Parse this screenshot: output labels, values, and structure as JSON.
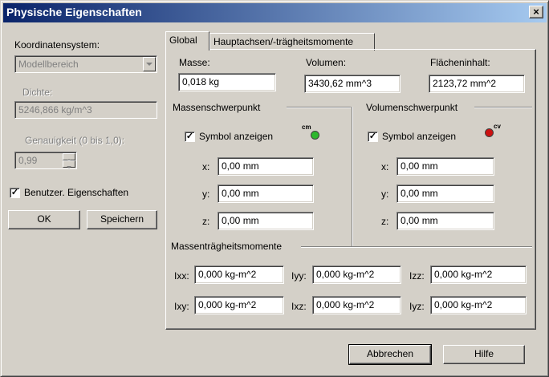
{
  "window": {
    "title": "Physische Eigenschaften",
    "close_glyph": "×"
  },
  "left": {
    "coord_label": "Koordinatensystem:",
    "coord_value": "Modellbereich",
    "density_label": "Dichte:",
    "density_value": "5246,866 kg/m^3",
    "accuracy_label": "Genauigkeit (0 bis 1,0):",
    "accuracy_value": "0,99",
    "user_props_label": "Benutzer. Eigenschaften",
    "user_props_checked": true,
    "ok_button": "OK",
    "save_button": "Speichern"
  },
  "tabs": [
    {
      "label": "Global",
      "active": true
    },
    {
      "label": "Hauptachsen/-trägheitsmomente",
      "active": false
    }
  ],
  "global": {
    "mass_label": "Masse:",
    "mass_value": "0,018 kg",
    "volume_label": "Volumen:",
    "volume_value": "3430,62 mm^3",
    "area_label": "Flächeninhalt:",
    "area_value": "2123,72 mm^2",
    "mass_center": {
      "group_label": "Massenschwerpunkt",
      "symbol_label": "Symbol anzeigen",
      "symbol_checked": true,
      "symbol_tag": "cm",
      "symbol_color": "#2eb82e",
      "x_label": "x:",
      "x_value": "0,00 mm",
      "y_label": "y:",
      "y_value": "0,00 mm",
      "z_label": "z:",
      "z_value": "0,00 mm"
    },
    "volume_center": {
      "group_label": "Volumenschwerpunkt",
      "symbol_label": "Symbol anzeigen",
      "symbol_checked": true,
      "symbol_tag": "cv",
      "symbol_color": "#cc1111",
      "x_label": "x:",
      "x_value": "0,00 mm",
      "y_label": "y:",
      "y_value": "0,00 mm",
      "z_label": "z:",
      "z_value": "0,00 mm"
    },
    "inertia": {
      "group_label": "Massenträgheitsmomente",
      "ixx_label": "Ixx:",
      "ixx_value": "0,000 kg-m^2",
      "iyy_label": "Iyy:",
      "iyy_value": "0,000 kg-m^2",
      "izz_label": "Izz:",
      "izz_value": "0,000 kg-m^2",
      "ixy_label": "Ixy:",
      "ixy_value": "0,000 kg-m^2",
      "ixz_label": "Ixz:",
      "ixz_value": "0,000 kg-m^2",
      "iyz_label": "Iyz:",
      "iyz_value": "0,000 kg-m^2"
    }
  },
  "footer": {
    "cancel_button": "Abbrechen",
    "help_button": "Hilfe"
  }
}
